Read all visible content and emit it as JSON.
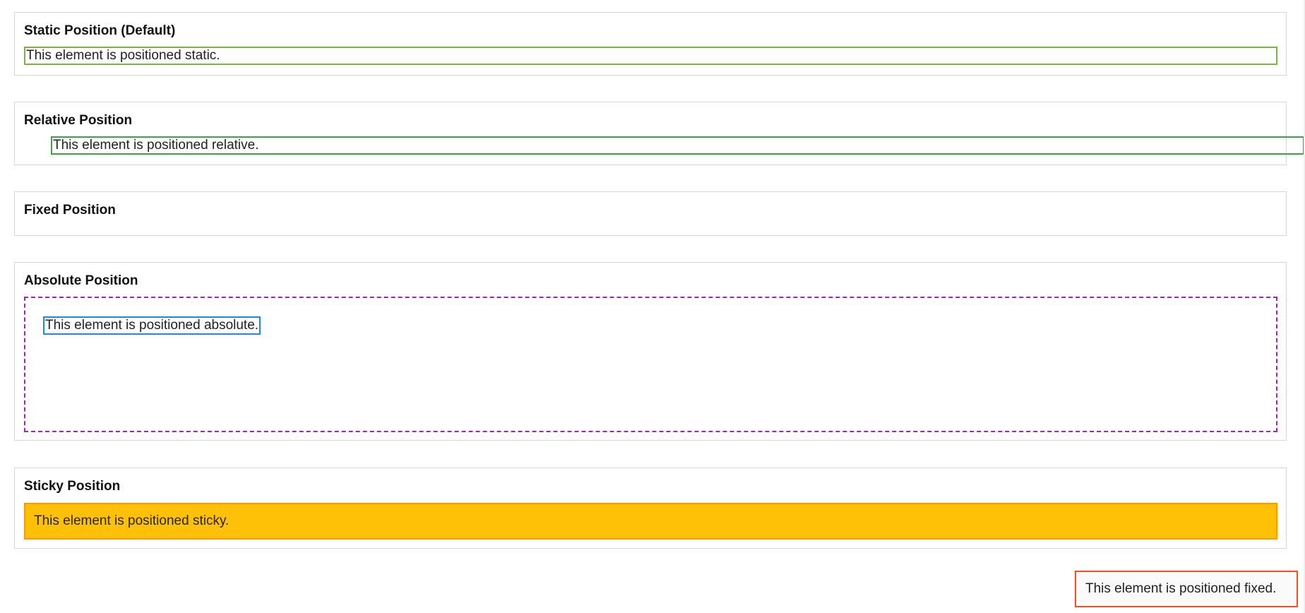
{
  "sections": {
    "static": {
      "title": "Static Position (Default)",
      "text": "This element is positioned static."
    },
    "relative": {
      "title": "Relative Position",
      "text": "This element is positioned relative."
    },
    "fixed": {
      "title": "Fixed Position",
      "text": "This element is positioned fixed."
    },
    "absolute": {
      "title": "Absolute Position",
      "text": "This element is positioned absolute."
    },
    "sticky": {
      "title": "Sticky Position",
      "text": "This element is positioned sticky."
    }
  },
  "colors": {
    "static_border": "#7cb342",
    "relative_border": "#43a047",
    "absolute_container_border": "#9c27b0",
    "absolute_border": "#1e88e5",
    "sticky_background": "#ffc107",
    "sticky_border": "#ff9800",
    "fixed_border": "#f4511e"
  }
}
